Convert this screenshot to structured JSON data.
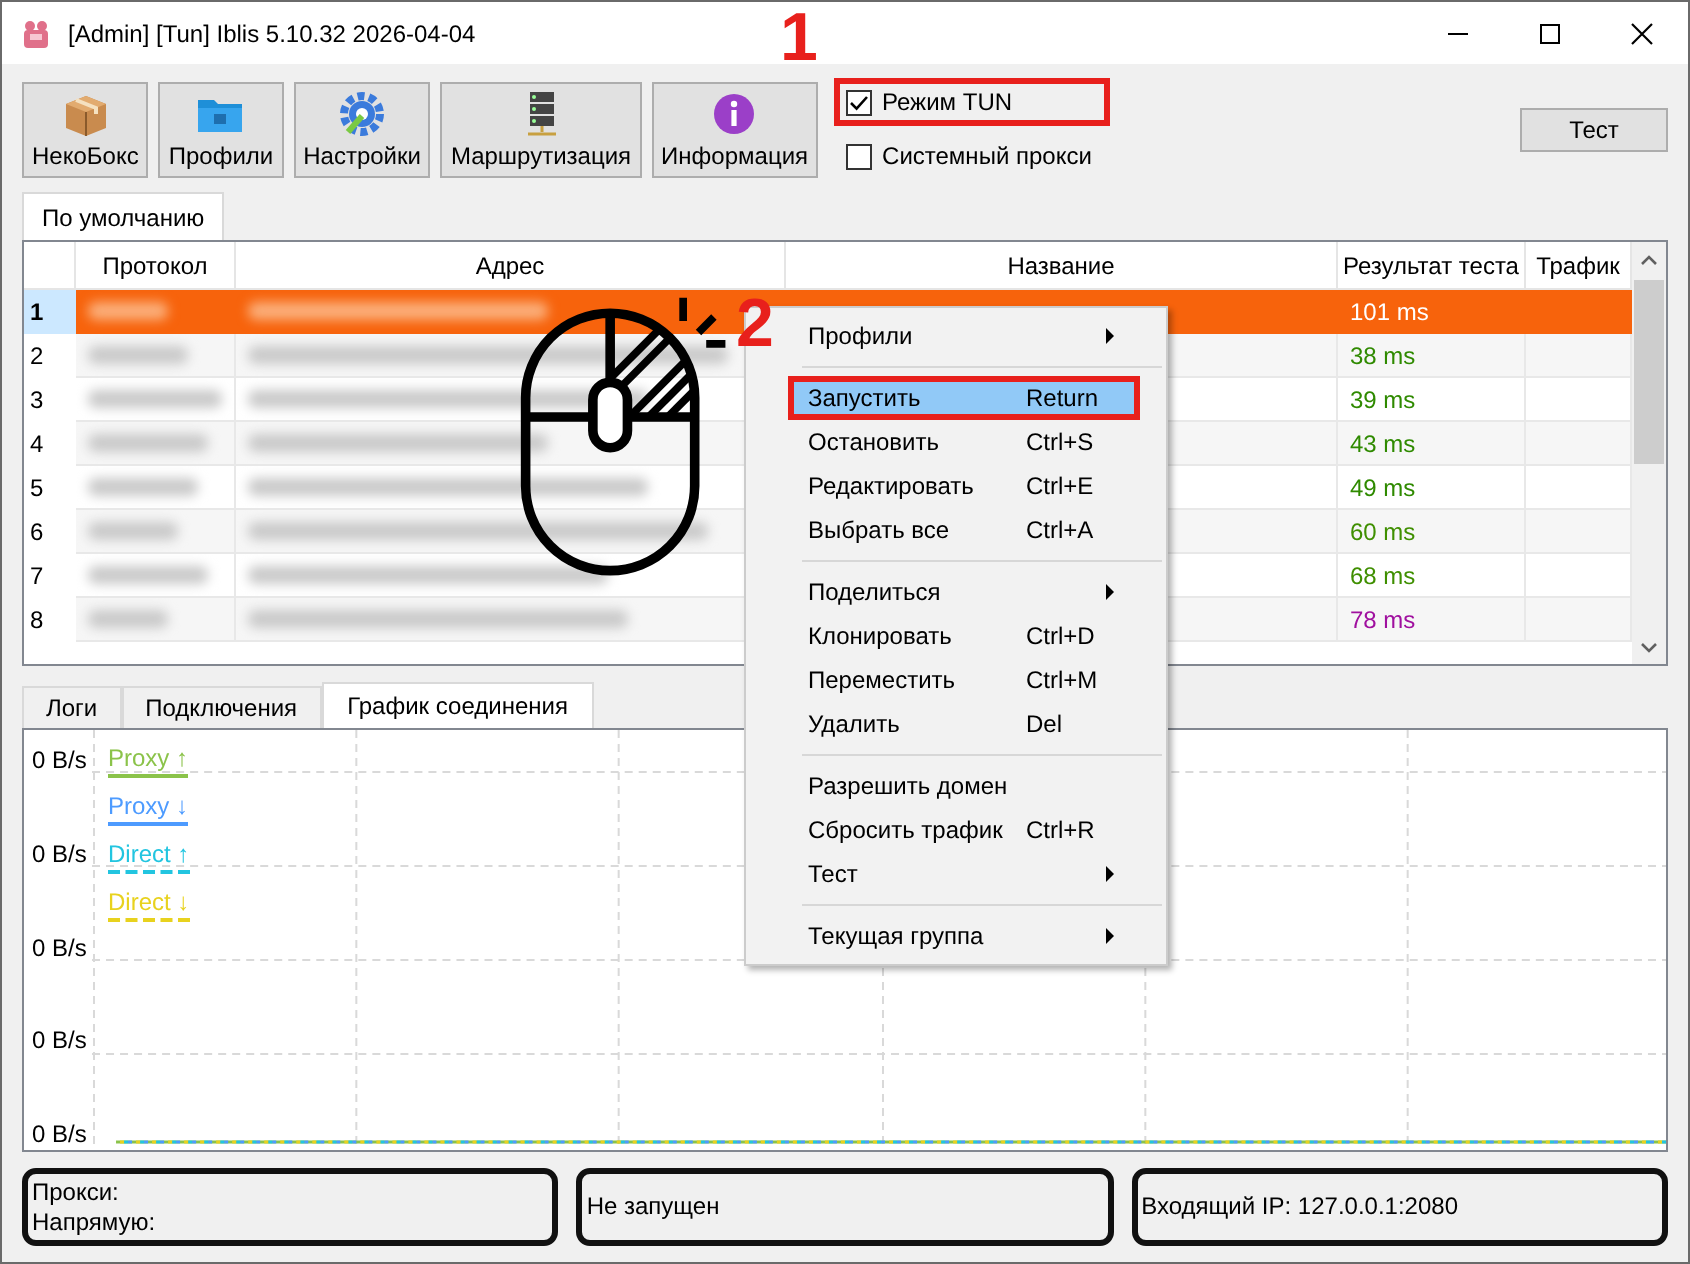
{
  "window": {
    "title": "[Admin] [Tun] Iblis 5.10.32 2026-04-04"
  },
  "toolbar": [
    {
      "label": "НекоБокс",
      "kind": "box"
    },
    {
      "label": "Профили",
      "kind": "folder"
    },
    {
      "label": "Настройки",
      "kind": "gear"
    },
    {
      "label": "Маршрутизация",
      "kind": "server"
    },
    {
      "label": "Информация",
      "kind": "info"
    }
  ],
  "options": [
    {
      "label": "Режим TUN",
      "checked": true,
      "highlighted": true
    },
    {
      "label": "Системный прокси",
      "checked": false,
      "highlighted": false
    }
  ],
  "test_button": "Тест",
  "group_tabs": [
    {
      "label": "По умолчанию",
      "selected": true
    }
  ],
  "table": {
    "columns": [
      "Протокол",
      "Адрес",
      "Название",
      "Результат теста",
      "Трафик"
    ],
    "rows": [
      {
        "number": "1",
        "selected": true,
        "latency": "101 ms"
      },
      {
        "number": "2",
        "selected": false,
        "latency": "38 ms",
        "color": "#2f8a00"
      },
      {
        "number": "3",
        "selected": false,
        "latency": "39 ms",
        "color": "#2f8a00"
      },
      {
        "number": "4",
        "selected": false,
        "latency": "43 ms",
        "color": "#2f8a00"
      },
      {
        "number": "5",
        "selected": false,
        "latency": "49 ms",
        "color": "#2f8a00"
      },
      {
        "number": "6",
        "selected": false,
        "latency": "60 ms",
        "color": "#3f8f00"
      },
      {
        "number": "7",
        "selected": false,
        "latency": "68 ms",
        "color": "#3f8f00"
      },
      {
        "number": "8",
        "selected": false,
        "latency": "78 ms",
        "color": "#a0109f"
      }
    ]
  },
  "bottom_tabs": [
    {
      "label": "Логи",
      "selected": false
    },
    {
      "label": "Подключения",
      "selected": false
    },
    {
      "label": "График соединения",
      "selected": true
    }
  ],
  "chart": {
    "y_labels": [
      "0 B/s",
      "0 B/s",
      "0 B/s",
      "0 B/s",
      "0 B/s"
    ],
    "legend": [
      {
        "label": "Proxy ↑",
        "color": "#8bc34a",
        "kind": "solid"
      },
      {
        "label": "Proxy ↓",
        "color": "#4d9bff",
        "kind": "solid"
      },
      {
        "label": "Direct ↑",
        "color": "#22c5e0",
        "kind": "dashed"
      },
      {
        "label": "Direct ↓",
        "color": "#e8d21e",
        "kind": "dashed"
      }
    ]
  },
  "context_menu": {
    "items": [
      {
        "kind": "item",
        "label": "Профили",
        "submenu": true,
        "selected": false,
        "highlighted": false
      },
      {
        "kind": "separator"
      },
      {
        "kind": "item",
        "label": "Запустить",
        "shortcut": "Return",
        "submenu": false,
        "selected": true,
        "highlighted": true
      },
      {
        "kind": "item",
        "label": "Остановить",
        "shortcut": "Ctrl+S",
        "submenu": false,
        "selected": false,
        "highlighted": false
      },
      {
        "kind": "item",
        "label": "Редактировать",
        "shortcut": "Ctrl+E",
        "submenu": false,
        "selected": false,
        "highlighted": false
      },
      {
        "kind": "item",
        "label": "Выбрать все",
        "shortcut": "Ctrl+A",
        "submenu": false,
        "selected": false,
        "highlighted": false
      },
      {
        "kind": "separator"
      },
      {
        "kind": "item",
        "label": "Поделиться",
        "submenu": true,
        "selected": false,
        "highlighted": false
      },
      {
        "kind": "item",
        "label": "Клонировать",
        "shortcut": "Ctrl+D",
        "submenu": false,
        "selected": false,
        "highlighted": false
      },
      {
        "kind": "item",
        "label": "Переместить",
        "shortcut": "Ctrl+M",
        "submenu": false,
        "selected": false,
        "highlighted": false
      },
      {
        "kind": "item",
        "label": "Удалить",
        "shortcut": "Del",
        "submenu": false,
        "selected": false,
        "highlighted": false
      },
      {
        "kind": "separator"
      },
      {
        "kind": "item",
        "label": "Разрешить домен",
        "submenu": false,
        "selected": false,
        "highlighted": false
      },
      {
        "kind": "item",
        "label": "Сбросить трафик",
        "shortcut": "Ctrl+R",
        "submenu": false,
        "selected": false,
        "highlighted": false
      },
      {
        "kind": "item",
        "label": "Тест",
        "submenu": true,
        "selected": false,
        "highlighted": false
      },
      {
        "kind": "separator"
      },
      {
        "kind": "item",
        "label": "Текущая группа",
        "submenu": true,
        "selected": false,
        "highlighted": false
      }
    ]
  },
  "status_bar": [
    {
      "lines": [
        "Прокси:",
        "Напрямую:"
      ]
    },
    {
      "lines": [
        "Не запущен"
      ]
    },
    {
      "lines": [
        "Входящий IP: 127.0.0.1:2080"
      ]
    }
  ],
  "annotations": [
    {
      "text": "1"
    },
    {
      "text": "2"
    }
  ]
}
